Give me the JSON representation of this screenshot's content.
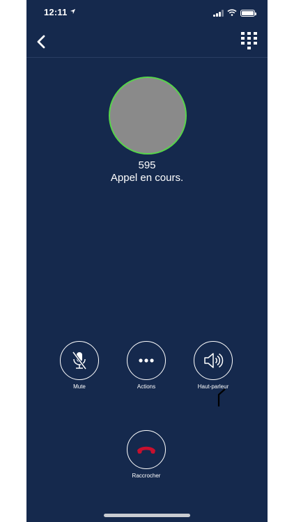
{
  "status_bar": {
    "time": "12:11",
    "location_icon": "location-arrow-icon",
    "signal_icon": "cellular-signal-icon",
    "wifi_icon": "wifi-icon",
    "battery_icon": "battery-icon"
  },
  "nav": {
    "back_icon": "chevron-left-icon",
    "keypad_icon": "dialpad-icon"
  },
  "call": {
    "number": "595",
    "status": "Appel en cours.",
    "avatar_ring_color": "#57d44a"
  },
  "controls": {
    "mute_label": "Mute",
    "actions_label": "Actions",
    "speaker_label": "Haut-parleur",
    "hangup_label": "Raccrocher",
    "hangup_color": "#c8102e"
  },
  "theme": {
    "background": "#15294d"
  }
}
